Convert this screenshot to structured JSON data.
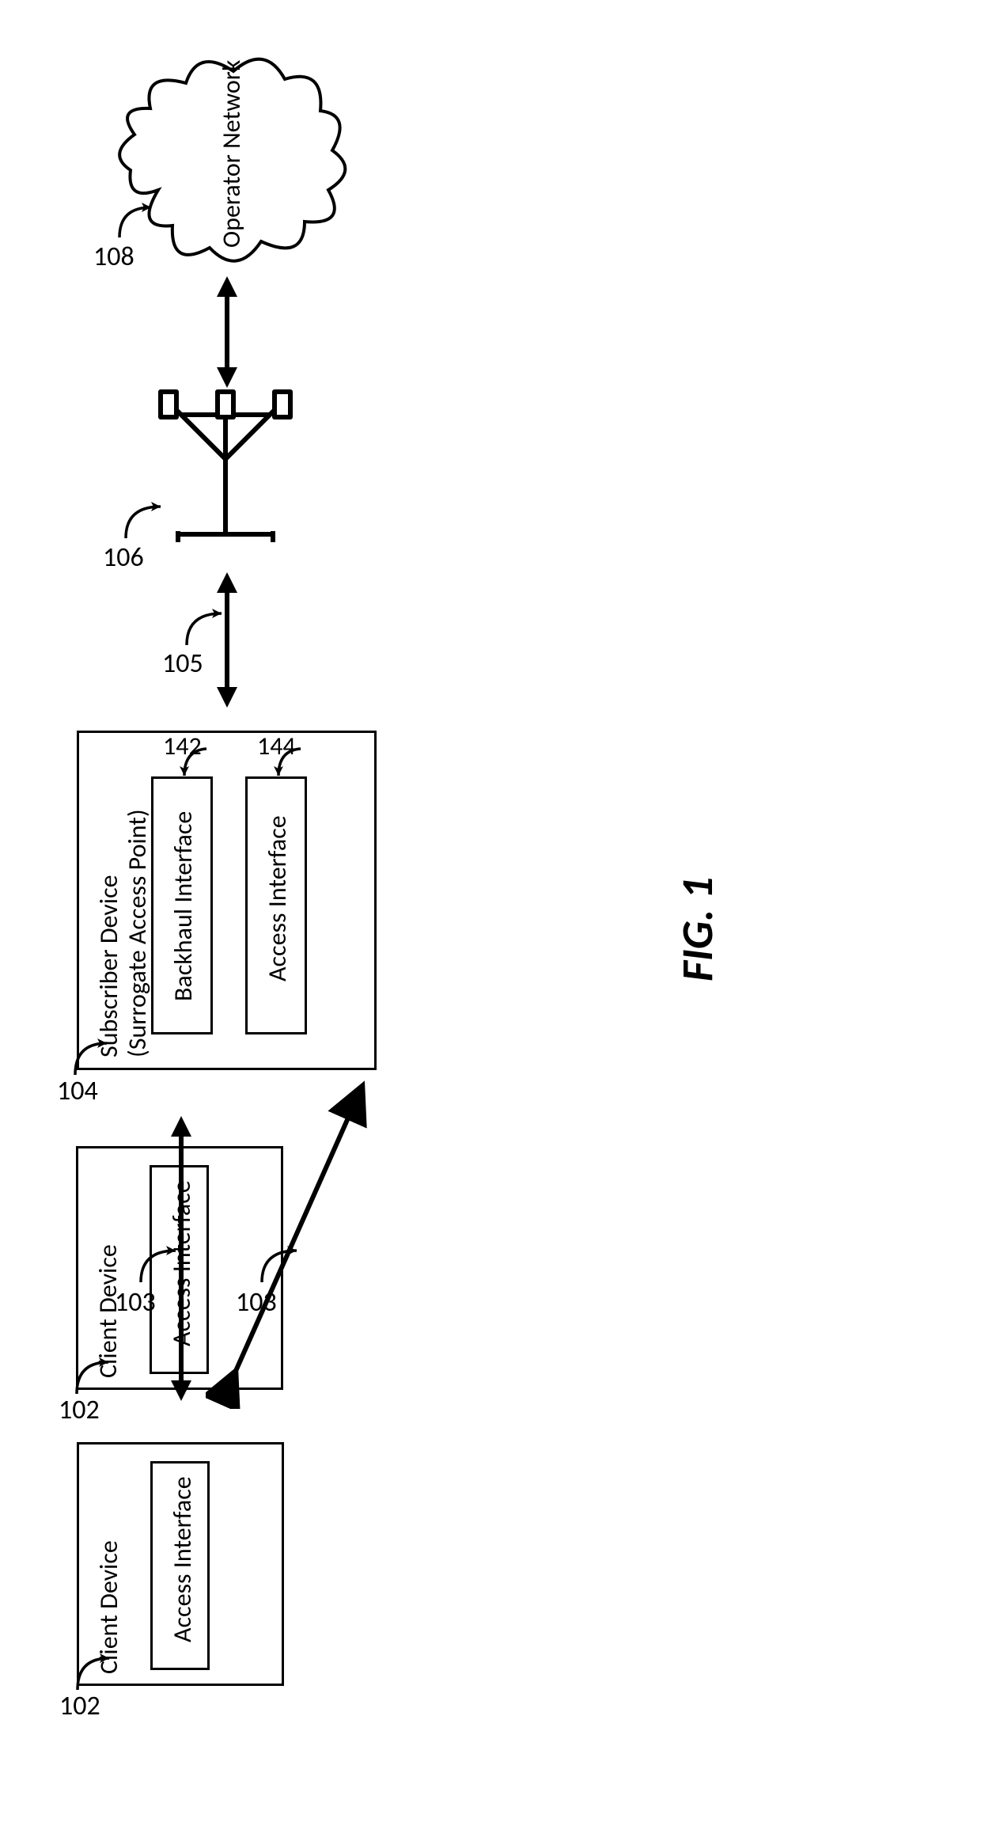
{
  "figure_label": "FIG. 1",
  "client1": {
    "ref": "102",
    "title": "Client Device",
    "inner": "Access Interface"
  },
  "client2": {
    "ref": "102",
    "title": "Client Device",
    "inner": "Access Interface"
  },
  "subscriber": {
    "ref": "104",
    "title_line1": "Subscriber Device",
    "title_line2": "(Surrogate Access Point)",
    "backhaul": {
      "ref": "142",
      "label": "Backhaul Interface"
    },
    "access": {
      "ref": "144",
      "label": "Access Interface"
    }
  },
  "link_client_to_sub": {
    "ref": "103"
  },
  "link_client2_to_sub": {
    "ref": "103"
  },
  "link_sub_to_tower": {
    "ref": "105"
  },
  "tower": {
    "ref": "106"
  },
  "network": {
    "ref": "108",
    "label": "Operator Network"
  }
}
